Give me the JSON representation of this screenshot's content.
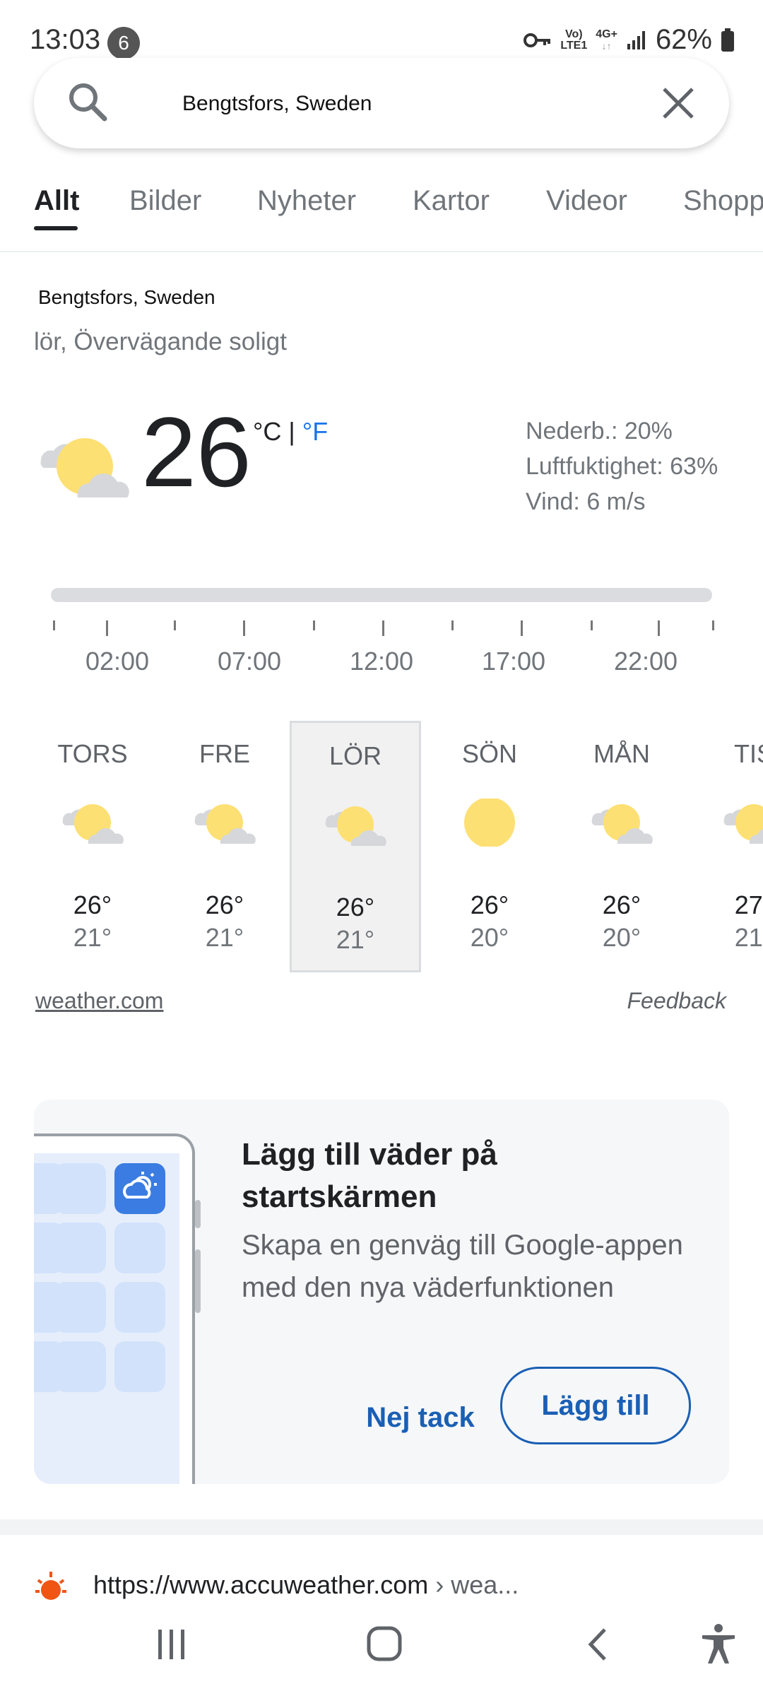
{
  "status_bar": {
    "time": "13:03",
    "notification_count": "6",
    "volte_line1": "Vo)",
    "volte_line2": "LTE1",
    "network": "4G+",
    "battery": "62%"
  },
  "search": {
    "query": "Bengtsfors, Sweden"
  },
  "tabs": [
    {
      "label": "Allt",
      "active": true
    },
    {
      "label": "Bilder"
    },
    {
      "label": "Nyheter"
    },
    {
      "label": "Kartor"
    },
    {
      "label": "Videor"
    },
    {
      "label": "Shopp"
    }
  ],
  "weather": {
    "location": "Bengtsfors, Sweden",
    "condition": "lör, Övervägande soligt",
    "temperature": "26",
    "unit_c": "°C",
    "unit_sep": "|",
    "unit_f": "°F",
    "precipitation": "Nederb.: 20%",
    "humidity": "Luftfuktighet: 63%",
    "wind": "Vind: 6 m/s",
    "hours": [
      "02:00",
      "07:00",
      "12:00",
      "17:00",
      "22:00"
    ],
    "days": [
      {
        "name": "TORS",
        "hi": "26°",
        "lo": "21°",
        "icon": "partly-sunny-icon"
      },
      {
        "name": "FRE",
        "hi": "26°",
        "lo": "21°",
        "icon": "partly-sunny-icon"
      },
      {
        "name": "LÖR",
        "hi": "26°",
        "lo": "21°",
        "icon": "partly-sunny-icon",
        "selected": true
      },
      {
        "name": "SÖN",
        "hi": "26°",
        "lo": "20°",
        "icon": "sun-icon"
      },
      {
        "name": "MÅN",
        "hi": "26°",
        "lo": "20°",
        "icon": "partly-sunny-icon"
      },
      {
        "name": "TIS",
        "hi": "27°",
        "lo": "21°",
        "icon": "partly-sunny-icon"
      }
    ],
    "source": "weather.com",
    "feedback": "Feedback"
  },
  "promo": {
    "title": "Lägg till väder på startskärmen",
    "body": "Skapa en genväg till Google-appen med den nya väderfunktionen",
    "decline": "Nej tack",
    "accept": "Lägg till"
  },
  "result": {
    "url": "https://www.accuweather.com",
    "path": " › wea..."
  },
  "colors": {
    "accent": "#1a73e8",
    "button_blue": "#1a5fb4",
    "sun": "#fde073",
    "cloud": "#d5d7da"
  }
}
